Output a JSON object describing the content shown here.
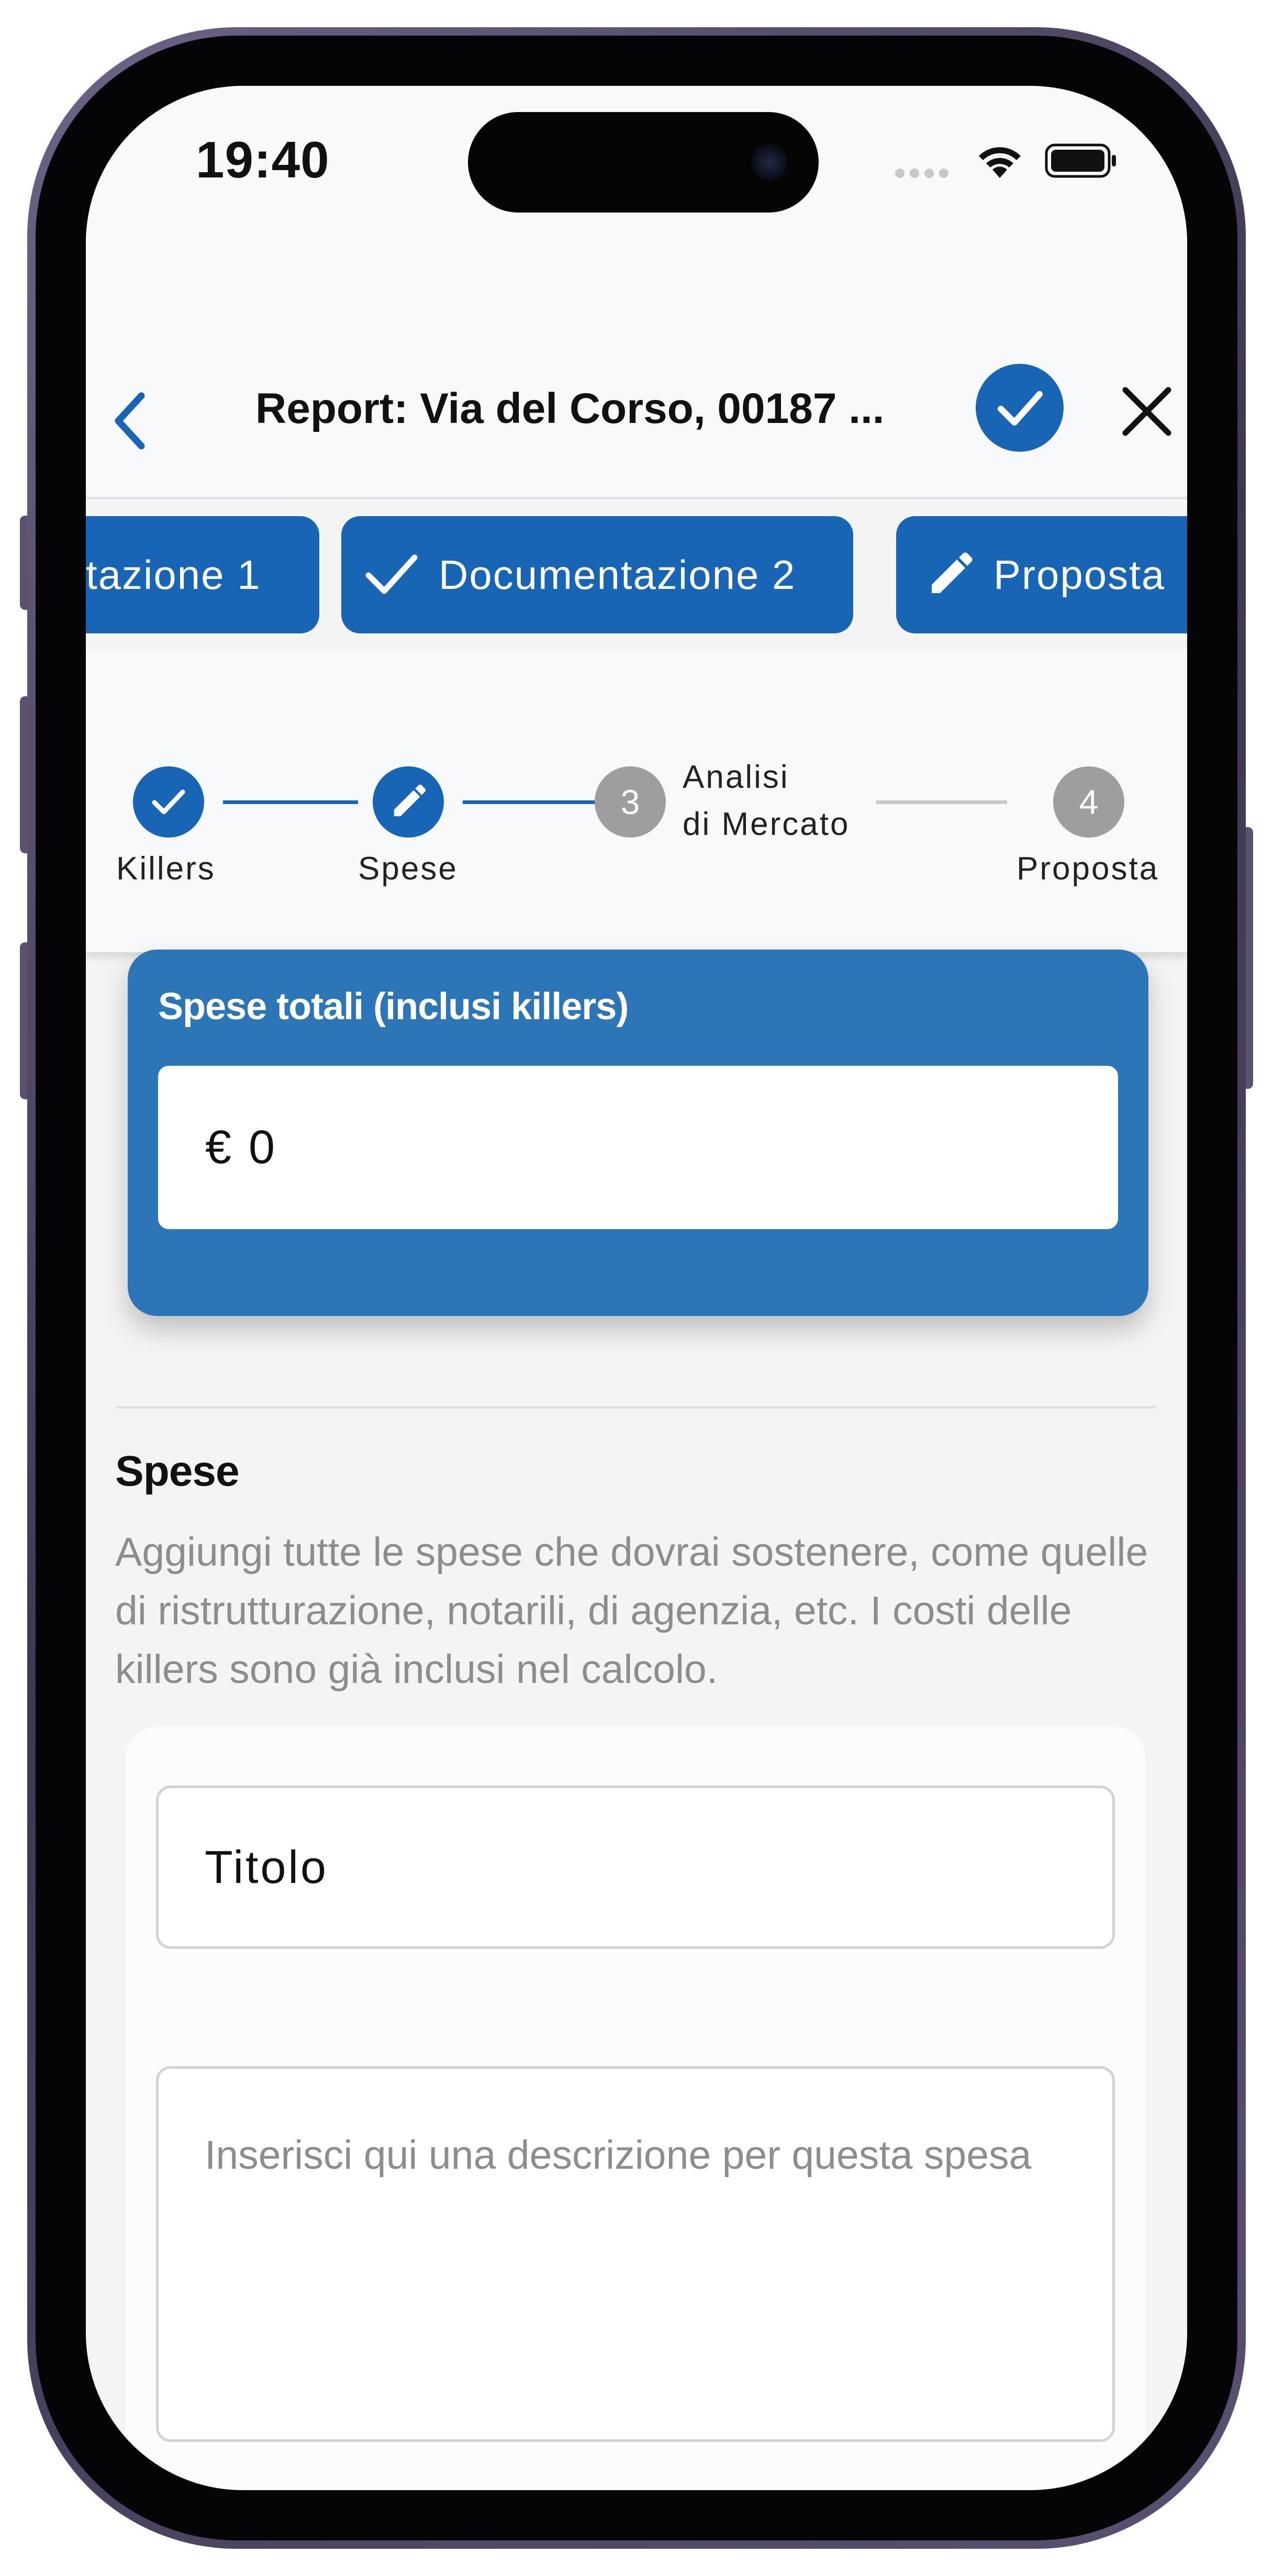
{
  "status_bar": {
    "time": "19:40"
  },
  "header": {
    "title": "Report: Via del Corso, 00187 ..."
  },
  "tabs": [
    {
      "label": "tazione 1",
      "icon": "none"
    },
    {
      "label": "Documentazione 2",
      "icon": "check-icon"
    },
    {
      "label": "Proposta",
      "icon": "pencil-icon"
    }
  ],
  "stepper": {
    "steps": [
      {
        "label": "Killers",
        "state": "done",
        "marker": ""
      },
      {
        "label": "Spese",
        "state": "active",
        "marker": ""
      },
      {
        "label_line1": "Analisi",
        "label_line2": "di Mercato",
        "state": "pending",
        "marker": "3"
      },
      {
        "label": "Proposta",
        "state": "pending",
        "marker": "4"
      }
    ]
  },
  "total": {
    "label": "Spese totali (inclusi killers)",
    "value": "€ 0"
  },
  "section": {
    "title": "Spese",
    "description": "Aggiungi tutte le spese che dovrai sostenere, come quelle di ristrutturazione, notarili, di agenzia, etc. I costi delle killers sono già inclusi nel calcolo."
  },
  "expense_form": {
    "title_placeholder": "Titolo",
    "description_placeholder": "Inserisci qui una descrizione per questa spesa"
  },
  "colors": {
    "primary": "#1765b4",
    "card_blue": "#2c76b8",
    "pending_step": "#9e9e9e",
    "muted_text": "#8d8d8d"
  }
}
